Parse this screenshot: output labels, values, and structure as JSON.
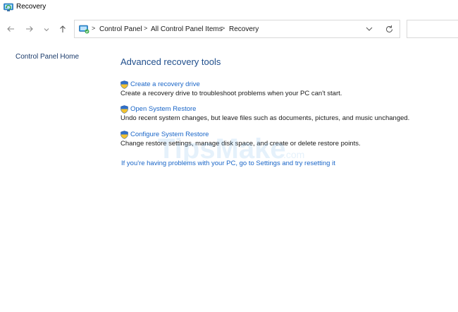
{
  "window": {
    "title": "Recovery"
  },
  "nav": {
    "back_icon": "back-arrow-icon",
    "forward_icon": "forward-arrow-icon",
    "recent_icon": "chevron-down-icon",
    "up_icon": "up-arrow-icon"
  },
  "address_bar": {
    "separator": ">",
    "crumbs": [
      "Control Panel",
      "All Control Panel Items",
      "Recovery"
    ]
  },
  "sidebar": {
    "home_label": "Control Panel Home"
  },
  "main": {
    "title": "Advanced recovery tools",
    "tasks": [
      {
        "link": "Create a recovery drive",
        "description": "Create a recovery drive to troubleshoot problems when your PC can't start."
      },
      {
        "link": "Open System Restore",
        "description": "Undo recent system changes, but leave files such as documents, pictures, and music unchanged."
      },
      {
        "link": "Configure System Restore",
        "description": "Change restore settings, manage disk space, and create or delete restore points."
      }
    ],
    "settings_link": "If you're having problems with your PC, go to Settings and try resetting it"
  },
  "watermark": {
    "text": "TipsMake",
    "suffix": ".com"
  },
  "colors": {
    "link": "#1a66c8",
    "heading": "#1f4e8c",
    "shield_blue": "#2f6fc9",
    "shield_yellow": "#f2c230"
  }
}
